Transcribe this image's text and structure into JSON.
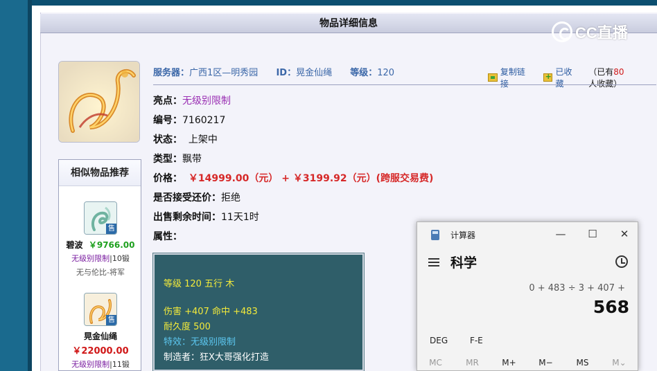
{
  "panel": {
    "title": "物品详细信息"
  },
  "logo": {
    "text": "CC直播"
  },
  "info": {
    "server_label": "服务器：",
    "server_value": "广西1区—明秀园",
    "id_label": "ID：",
    "id_value": "晃金仙绳",
    "level_label": "等级：",
    "level_value": "120"
  },
  "actions": {
    "copy_link": "复制链接",
    "favorited": "已收藏",
    "collect_prefix": "（已有",
    "collect_count": "80",
    "collect_suffix": "人收藏）"
  },
  "details": {
    "highlight_label": "亮点：",
    "highlight_value": "无级别限制",
    "number_label": "编号：",
    "number_value": "7160217",
    "status_label": "状态：",
    "status_value": "上架中",
    "type_label": "类型：",
    "type_value": "飘带",
    "price_label": "价格：",
    "price_value": "￥14999.00（元） + ￥3199.92（元）(跨服交易费)",
    "bargain_label": "是否接受还价：",
    "bargain_value": "拒绝",
    "time_label": "出售剩余时间：",
    "time_value": "11天1时",
    "attr_label": "属性："
  },
  "attributes": {
    "line1": "等级 120 五行 木",
    "line2": "伤害 +407 命中 +483",
    "line3": "耐久度 500",
    "line4": "特效：无级别限制",
    "line5": "制造者：狂X大哥强化打造"
  },
  "similar": {
    "title": "相似物品推荐",
    "items": [
      {
        "name": "碧波",
        "price": "￥9766.00",
        "tag": "无级别限制",
        "lvl": "|10锻",
        "sub": "无与伦比-将军",
        "sale": "售"
      },
      {
        "name": "晃金仙绳",
        "price": "￥22000.00",
        "tag": "无级别限制",
        "lvl": "|11锻",
        "sale": "售"
      }
    ]
  },
  "calculator": {
    "title": "计算器",
    "mode": "科学",
    "expression": "0 + 483 ÷ 3 + 407 +",
    "result": "568",
    "deg": "DEG",
    "fe": "F-E",
    "memory": [
      "MC",
      "MR",
      "M+",
      "M−",
      "MS",
      "M⌄"
    ],
    "minimize": "—",
    "maximize": "☐",
    "close": "✕"
  },
  "colors": {
    "accent_blue": "#3b67a8",
    "price_red": "#d62828",
    "purple": "#9a2fb3",
    "attr_bg": "#2f5e69"
  }
}
